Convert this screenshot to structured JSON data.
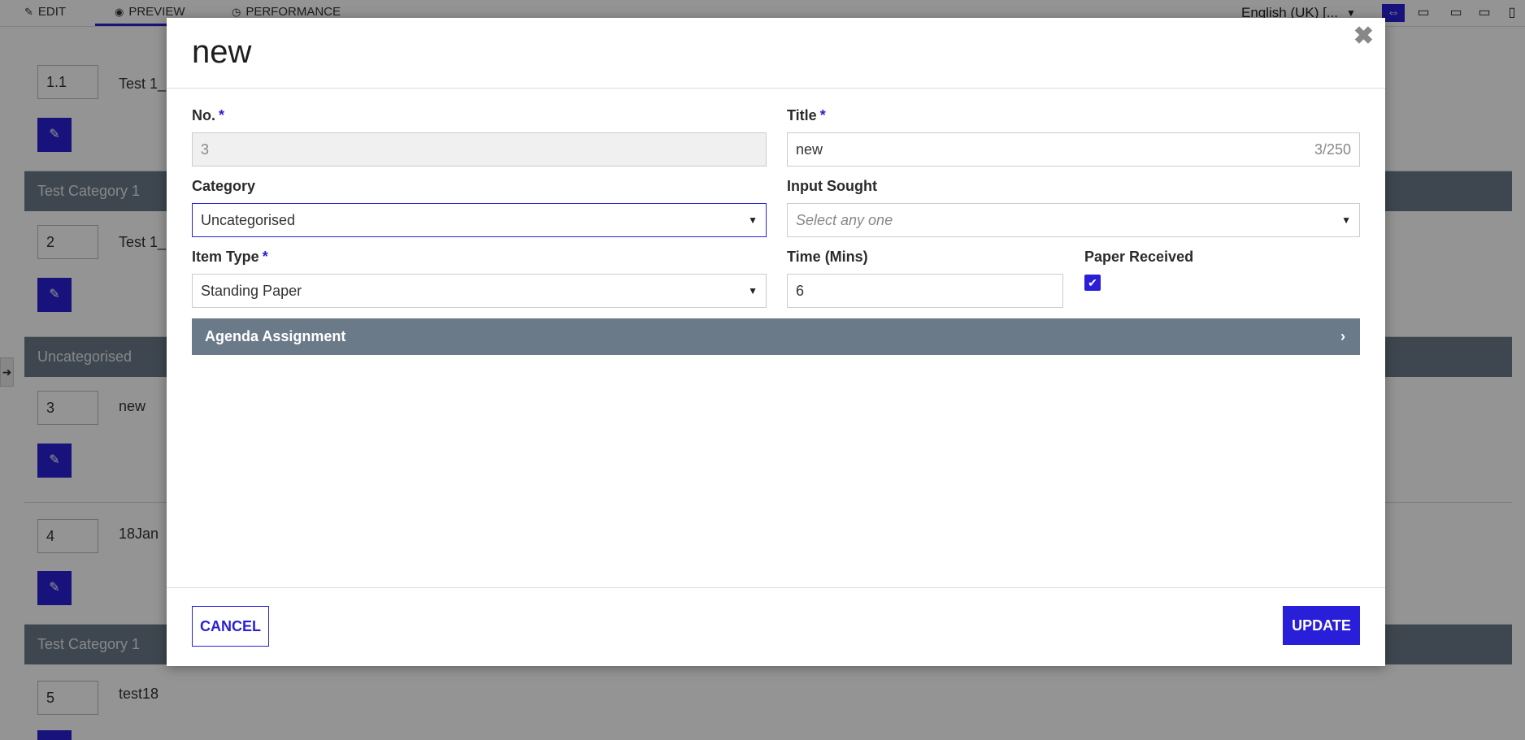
{
  "topbar": {
    "tabs": [
      {
        "label": "EDIT",
        "icon": "edit-icon"
      },
      {
        "label": "PREVIEW",
        "icon": "eye-icon"
      },
      {
        "label": "PERFORMANCE",
        "icon": "clock-icon"
      }
    ],
    "language": "English (UK) [...",
    "devices": [
      "fit-width-icon",
      "desktop-icon",
      "laptop-icon",
      "tablet-icon",
      "mobile-icon"
    ]
  },
  "list": {
    "categories": [
      "Test Category 1",
      "Uncategorised",
      "Test Category 1"
    ],
    "items": [
      {
        "number": "1.1",
        "title": "Test 1_"
      },
      {
        "number": "2",
        "title": "Test 1_"
      },
      {
        "number": "3",
        "title": "new"
      },
      {
        "number": "4",
        "title": "18Jan"
      },
      {
        "number": "5",
        "title": "test18"
      }
    ]
  },
  "modal": {
    "title": "new",
    "close_icon": "close-icon",
    "fields": {
      "no": {
        "label": "No.",
        "value": "3"
      },
      "title": {
        "label": "Title",
        "value": "new",
        "counter": "3/250"
      },
      "category": {
        "label": "Category",
        "value": "Uncategorised"
      },
      "input_sought": {
        "label": "Input Sought",
        "placeholder": "Select any one"
      },
      "item_type": {
        "label": "Item Type",
        "value": "Standing Paper"
      },
      "time": {
        "label": "Time (Mins)",
        "value": "6"
      },
      "paper_received": {
        "label": "Paper Received",
        "checked": true
      }
    },
    "accordion": {
      "label": "Agenda Assignment"
    },
    "buttons": {
      "cancel": "CANCEL",
      "update": "UPDATE"
    }
  },
  "colors": {
    "accent": "#2a1fd8",
    "category_header": "#6b7a88"
  }
}
